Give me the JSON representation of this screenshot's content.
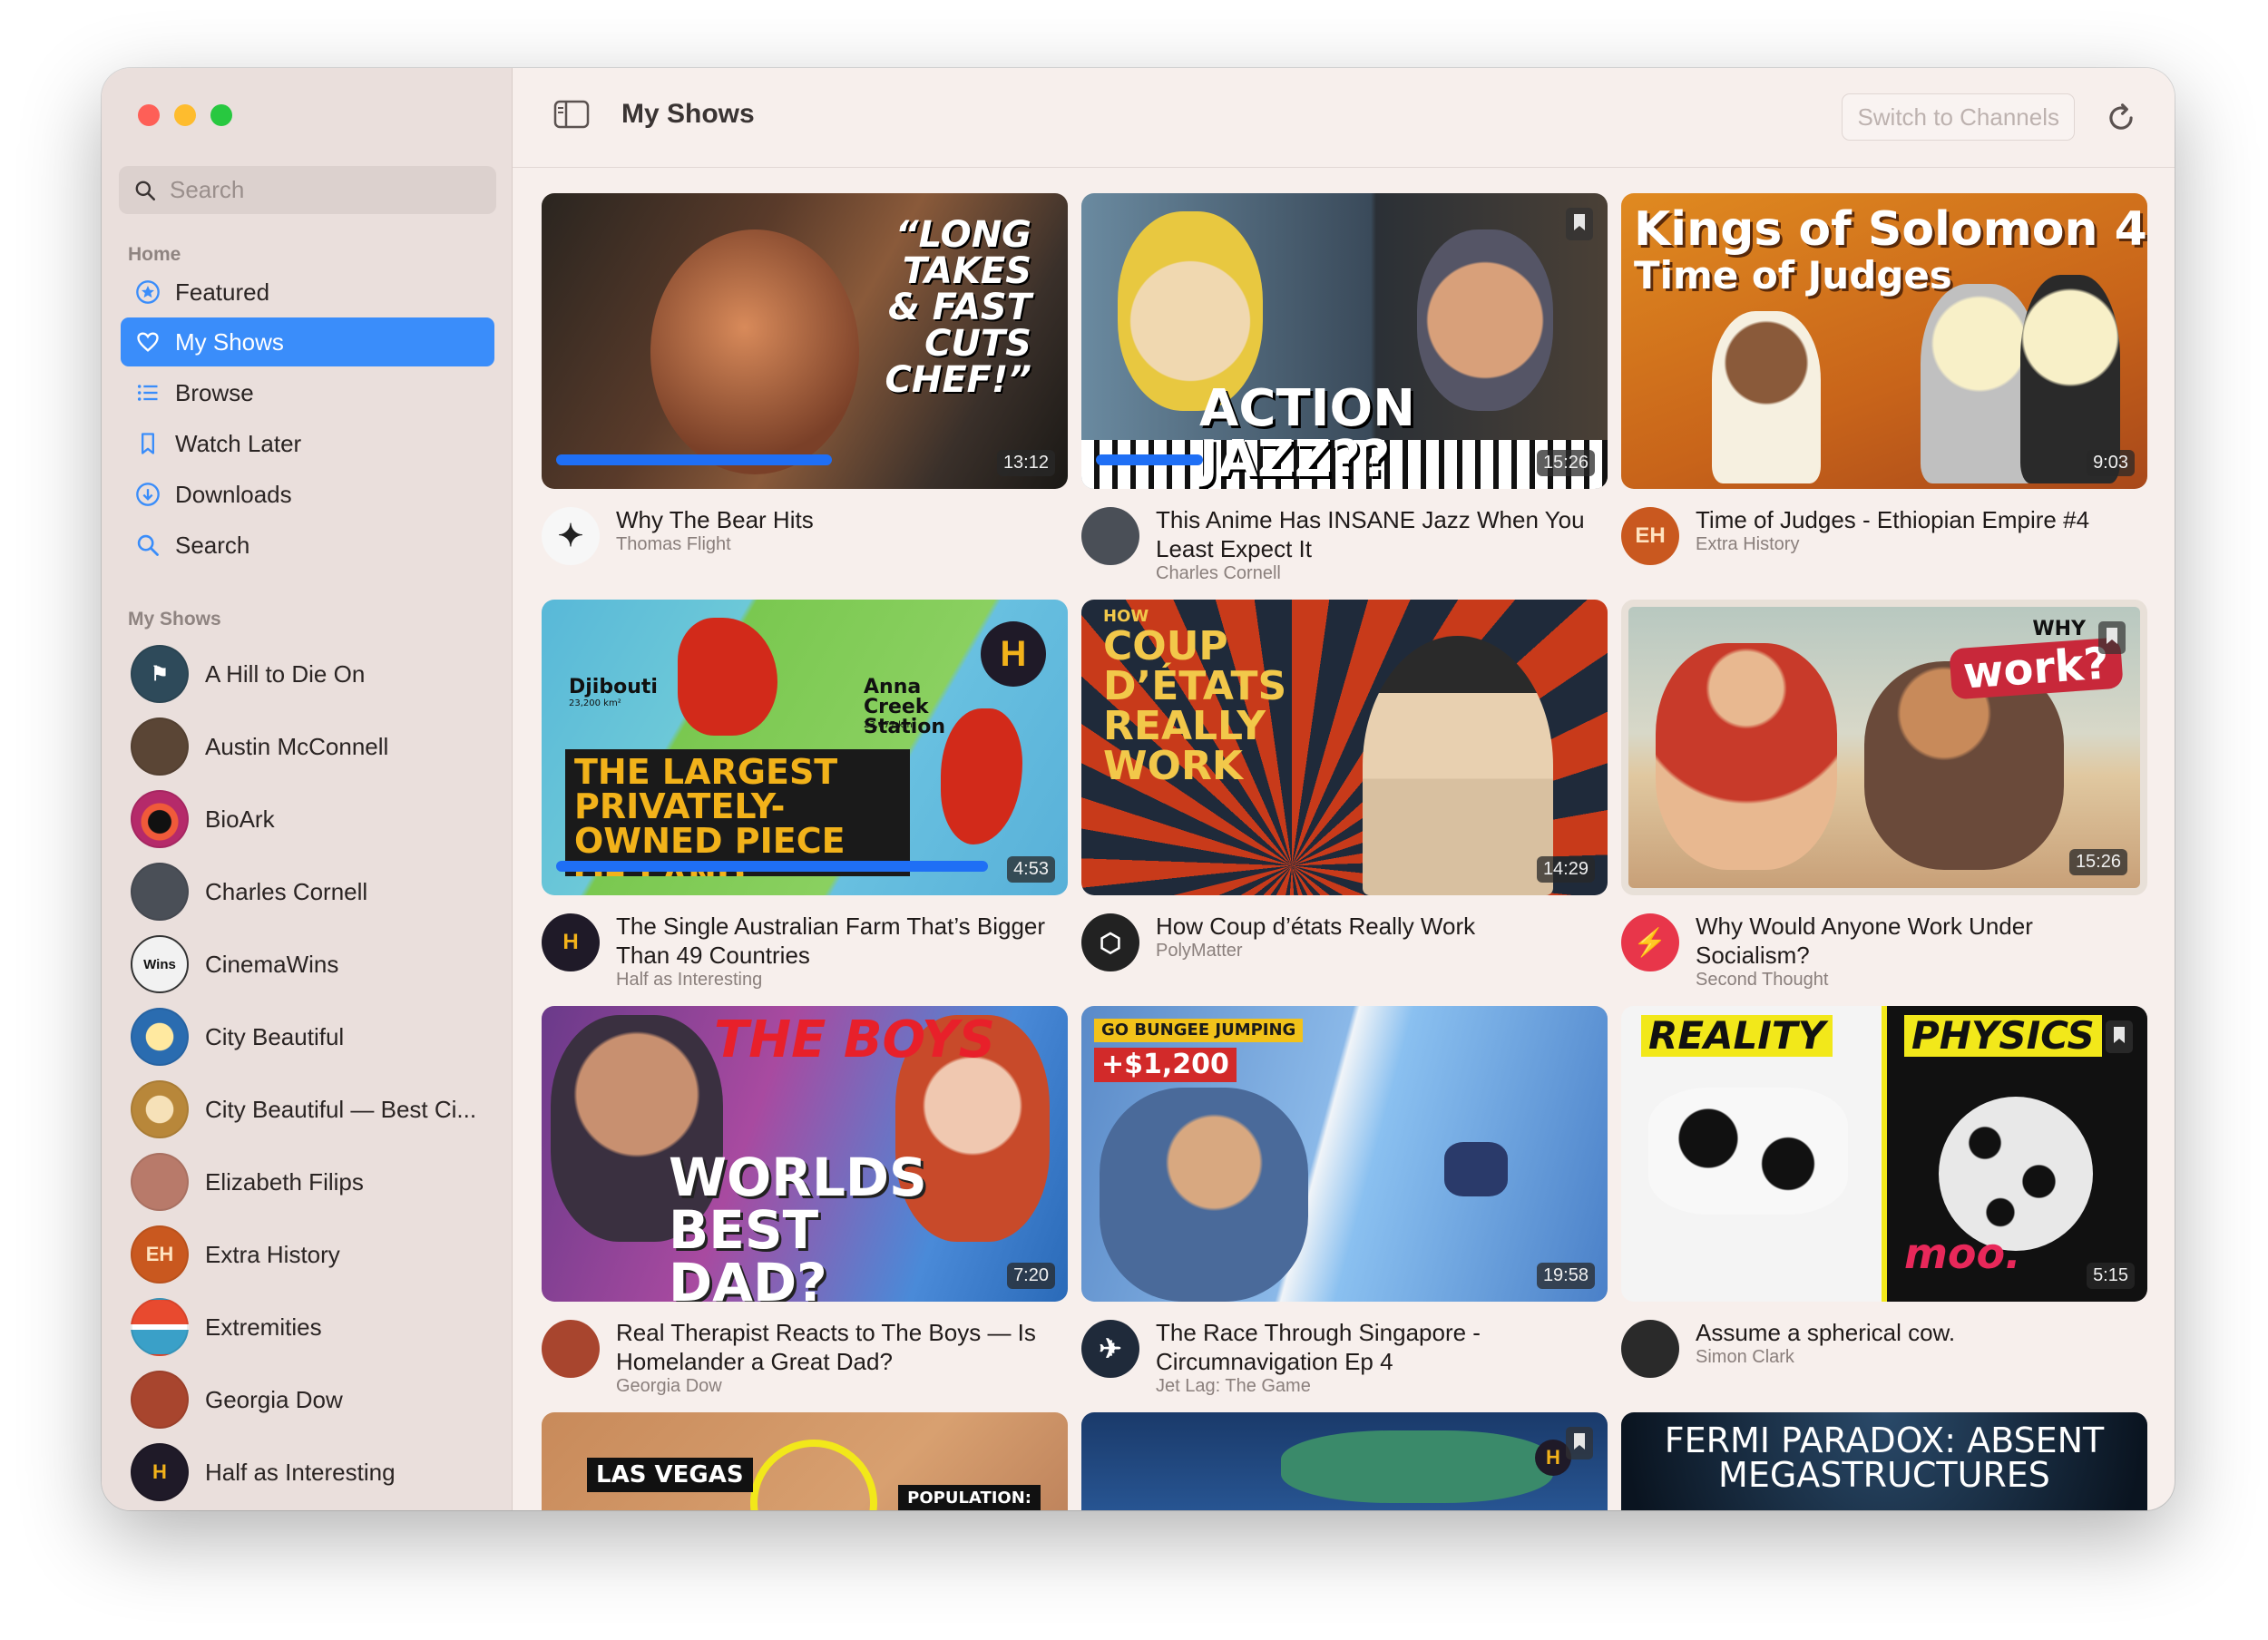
{
  "sidebar": {
    "search_placeholder": "Search",
    "home_heading": "Home",
    "nav": [
      {
        "label": "Featured"
      },
      {
        "label": "My Shows"
      },
      {
        "label": "Browse"
      },
      {
        "label": "Watch Later"
      },
      {
        "label": "Downloads"
      },
      {
        "label": "Search"
      }
    ],
    "shows_heading": "My Shows",
    "shows": [
      {
        "name": "A Hill to Die On",
        "color": "#2e4a5a"
      },
      {
        "name": "Austin McConnell",
        "color": "#5a4535"
      },
      {
        "name": "BioArk",
        "color": "#c23a5a"
      },
      {
        "name": "Charles Cornell",
        "color": "#4a4f57"
      },
      {
        "name": "CinemaWins",
        "color": "#f2f2f2"
      },
      {
        "name": "City Beautiful",
        "color": "#2a6cb0"
      },
      {
        "name": "City Beautiful — Best Ci...",
        "color": "#b8873a"
      },
      {
        "name": "Elizabeth Filips",
        "color": "#b87a6a"
      },
      {
        "name": "Extra History",
        "color": "#c9581f"
      },
      {
        "name": "Extremities",
        "color": "#e84a2f"
      },
      {
        "name": "Georgia Dow",
        "color": "#a8452e"
      },
      {
        "name": "Half as Interesting",
        "color": "#1f1a28"
      }
    ]
  },
  "toolbar": {
    "title": "My Shows",
    "switch_label": "Switch to Channels"
  },
  "videos": [
    {
      "title": "Why The Bear Hits",
      "channel": "Thomas Flight",
      "duration": "13:12",
      "thumb_text": "“LONG TAKES & FAST CUTS CHEF!”",
      "progress": 0.53
    },
    {
      "title": "This Anime Has INSANE Jazz When You Least Expect It",
      "channel": "Charles Cornell",
      "duration": "15:26",
      "thumb_text": "ACTION JAZZ??",
      "progress": 0.21
    },
    {
      "title": "Time of Judges - Ethiopian Empire #4",
      "channel": "Extra History",
      "duration": "9:03",
      "thumb_text": "Kings of Solomon 4",
      "thumb_text2": "Time of Judges"
    },
    {
      "title": "The Single Australian Farm That’s Bigger Than 49 Countries",
      "channel": "Half as Interesting",
      "duration": "4:53",
      "thumb_text": "THE LARGEST PRIVATELY-OWNED PIECE OF LAND",
      "map_label1": "Djibouti",
      "map_sub1": "23,200 km²",
      "map_label2": "Anna Creek Station",
      "map_sub2": "23,677 km²",
      "progress": 0.86
    },
    {
      "title": "How Coup d’états Really Work",
      "channel": "PolyMatter",
      "duration": "14:29",
      "thumb_small": "HOW",
      "thumb_text": "COUP D’ÉTATS REALLY WORK"
    },
    {
      "title": "Why Would Anyone Work Under Socialism?",
      "channel": "Second Thought",
      "duration": "15:26",
      "thumb_small": "WHY",
      "thumb_text": "work?"
    },
    {
      "title": "Real Therapist Reacts to The Boys — Is Homelander a Great Dad?",
      "channel": "Georgia Dow",
      "duration": "7:20",
      "thumb_small": "THE BOYS",
      "thumb_text": "WORLDS BEST DAD?"
    },
    {
      "title": "The Race Through Singapore - Circumnavigation Ep 4",
      "channel": "Jet Lag: The Game",
      "duration": "19:58",
      "thumb_small": "GO BUNGEE JUMPING",
      "thumb_text": "+$1,200"
    },
    {
      "title": "Assume a spherical cow.",
      "channel": "Simon Clark",
      "duration": "5:15",
      "thumb_small": "REALITY",
      "thumb_text": "PHYSICS",
      "thumb_text2": "moo."
    },
    {
      "title": "",
      "channel": "",
      "duration": "",
      "thumb_small": "LAS VEGAS",
      "thumb_text": "POPULATION:"
    },
    {
      "title": "",
      "channel": "",
      "duration": ""
    },
    {
      "title": "",
      "channel": "",
      "duration": "",
      "thumb_text": "FERMI PARADOX: ABSENT MEGASTRUCTURES"
    }
  ]
}
